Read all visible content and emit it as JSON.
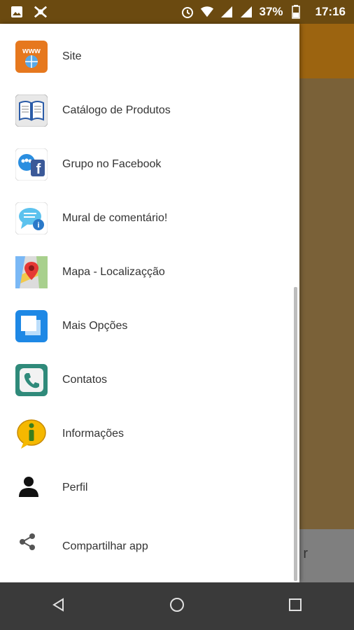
{
  "status_bar": {
    "battery": "37%",
    "time": "17:16",
    "icons": [
      "image-icon",
      "vpn-icon",
      "alarm-icon",
      "wifi-icon",
      "signal-icon",
      "signal-icon",
      "battery-icon"
    ]
  },
  "background": {
    "bottom_text": "r",
    "toolbar_color": "#9c6410",
    "content_color": "#7a6138"
  },
  "drawer": {
    "items": [
      {
        "label": "Site",
        "icon": "www-globe-icon"
      },
      {
        "label": "Catálogo de Produtos",
        "icon": "book-icon"
      },
      {
        "label": "Grupo no Facebook",
        "icon": "facebook-group-icon"
      },
      {
        "label": "Mural de comentário!",
        "icon": "chat-info-icon"
      },
      {
        "label": "Mapa - Localizaçção",
        "icon": "map-pin-icon"
      },
      {
        "label": "Mais Opções",
        "icon": "windows-icon"
      },
      {
        "label": "Contatos",
        "icon": "phone-icon"
      },
      {
        "label": "Informações",
        "icon": "info-icon"
      },
      {
        "label": "Perfil",
        "icon": "person-icon"
      },
      {
        "label": "Compartilhar app",
        "icon": "share-icon"
      }
    ]
  },
  "nav": {
    "buttons": [
      "back-icon",
      "home-icon",
      "recents-icon"
    ]
  }
}
